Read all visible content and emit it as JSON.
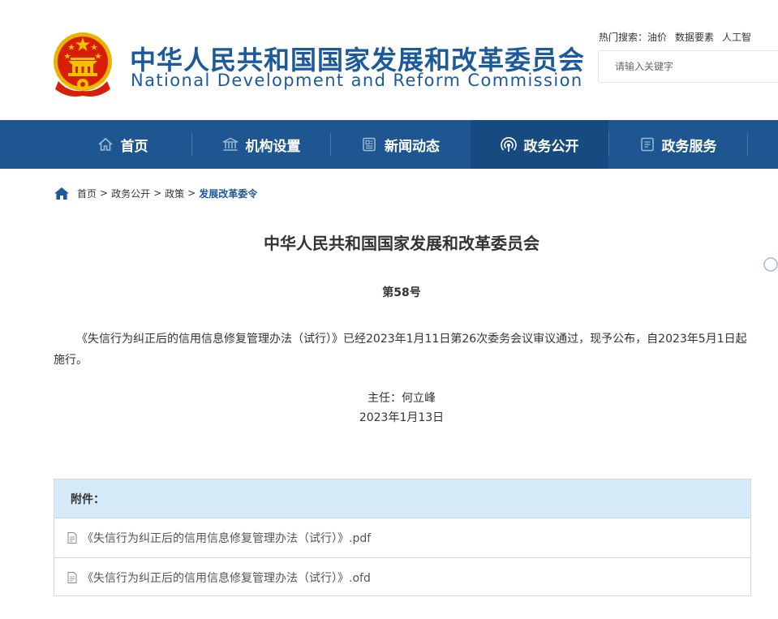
{
  "header": {
    "site_name_cn": "中华人民共和国国家发展和改革委员会",
    "site_name_en": "National Development and Reform Commission",
    "hot_search_label": "热门搜索：",
    "hot_search_items": [
      "油价",
      "数据要素",
      "人工智"
    ],
    "search_placeholder": "请输入关键字"
  },
  "nav": {
    "items": [
      {
        "label": "首页",
        "icon": "home-icon"
      },
      {
        "label": "机构设置",
        "icon": "institution-icon"
      },
      {
        "label": "新闻动态",
        "icon": "newspaper-icon"
      },
      {
        "label": "政务公开",
        "icon": "broadcast-icon",
        "active": true
      },
      {
        "label": "政务服务",
        "icon": "document-icon"
      }
    ]
  },
  "breadcrumb": {
    "items": [
      "首页",
      "政务公开",
      "政策"
    ],
    "separator": ">",
    "current": "发展改革委令"
  },
  "article": {
    "title": "中华人民共和国国家发展和改革委员会",
    "number": "第58号",
    "body": "《失信行为纠正后的信用信息修复管理办法（试行）》已经2023年1月11日第26次委务会议审议通过，现予公布，自2023年5月1日起施行。",
    "signer": "主任：何立峰",
    "date": "2023年1月13日"
  },
  "attachments": {
    "heading": "附件：",
    "files": [
      "《失信行为纠正后的信用信息修复管理办法（试行）》.pdf",
      "《失信行为纠正后的信用信息修复管理办法（试行）》.ofd"
    ]
  },
  "colors": {
    "brand_blue": "#1c5a9c",
    "nav_bg": "#1e5691",
    "nav_active": "#174a80",
    "attachment_header": "#d6ebfa",
    "emblem_red": "#d81e06",
    "emblem_gold": "#f2c200"
  }
}
